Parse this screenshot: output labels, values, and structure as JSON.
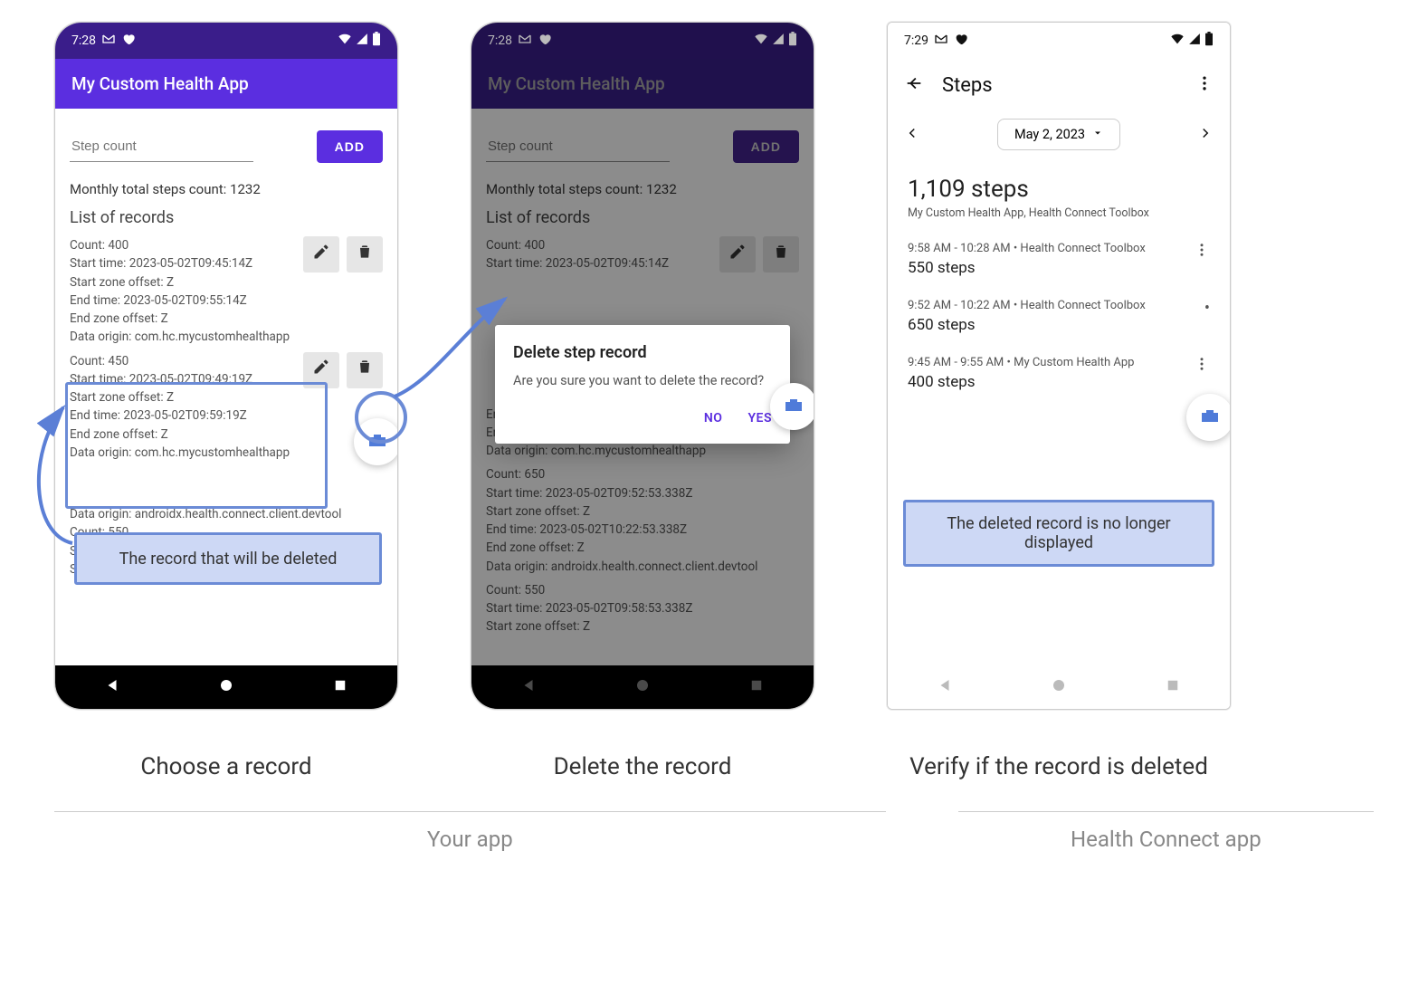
{
  "status": {
    "time1": "7:28",
    "time2": "7:28",
    "time3": "7:29"
  },
  "app": {
    "title": "My Custom Health App",
    "step_placeholder": "Step count",
    "add_label": "ADD",
    "monthly_total": "Monthly total steps count: 1232",
    "list_title": "List of records"
  },
  "records": {
    "r1": {
      "count": "Count: 400",
      "start": "Start time: 2023-05-02T09:45:14Z",
      "szo": "Start zone offset: Z",
      "end": "End time: 2023-05-02T09:55:14Z",
      "ezo": "End zone offset: Z",
      "origin": "Data origin: com.hc.mycustomhealthapp"
    },
    "r2": {
      "count": "Count: 450",
      "start": "Start time: 2023-05-02T09:49:19Z",
      "szo": "Start zone offset: Z",
      "end": "End time: 2023-05-02T09:59:19Z",
      "ezo": "End zone offset: Z",
      "origin": "Data origin: com.hc.mycustomhealthapp"
    },
    "r3": {
      "count": "Count: 650",
      "start": "Start time: 2023-05-02T09:52:53.338Z",
      "szo": "Start zone offset: Z",
      "end": "End time: 2023-05-02T10:22:53.338Z",
      "ezo": "End zone offset: Z",
      "origin": "Data origin: androidx.health.connect.client.devtool"
    },
    "r4": {
      "count": "Count: 550",
      "start": "Start time: 2023-05-02T09:58:53.338Z",
      "szo": "Start zone offset: Z"
    }
  },
  "dialog": {
    "title": "Delete step record",
    "message": "Are you sure you want to delete the record?",
    "no": "NO",
    "yes": "YES"
  },
  "hc": {
    "title": "Steps",
    "date": "May 2, 2023",
    "summary_steps": "1,109 steps",
    "summary_sources": "My Custom Health App, Health Connect Toolbox",
    "e1_meta": "9:58 AM - 10:28 AM • Health Connect Toolbox",
    "e1_val": "550 steps",
    "e2_meta": "9:52 AM - 10:22 AM • Health Connect Toolbox",
    "e2_val": "650 steps",
    "e3_meta": "9:45 AM - 9:55 AM • My Custom Health App",
    "e3_val": "400 steps"
  },
  "annotations": {
    "box1": "The record that will be deleted",
    "box2": "The deleted record is no longer displayed"
  },
  "captions": {
    "c1": "Choose a record",
    "c2": "Delete the record",
    "c3": "Verify if the record is deleted",
    "s1": "Your app",
    "s2": "Health Connect app"
  }
}
